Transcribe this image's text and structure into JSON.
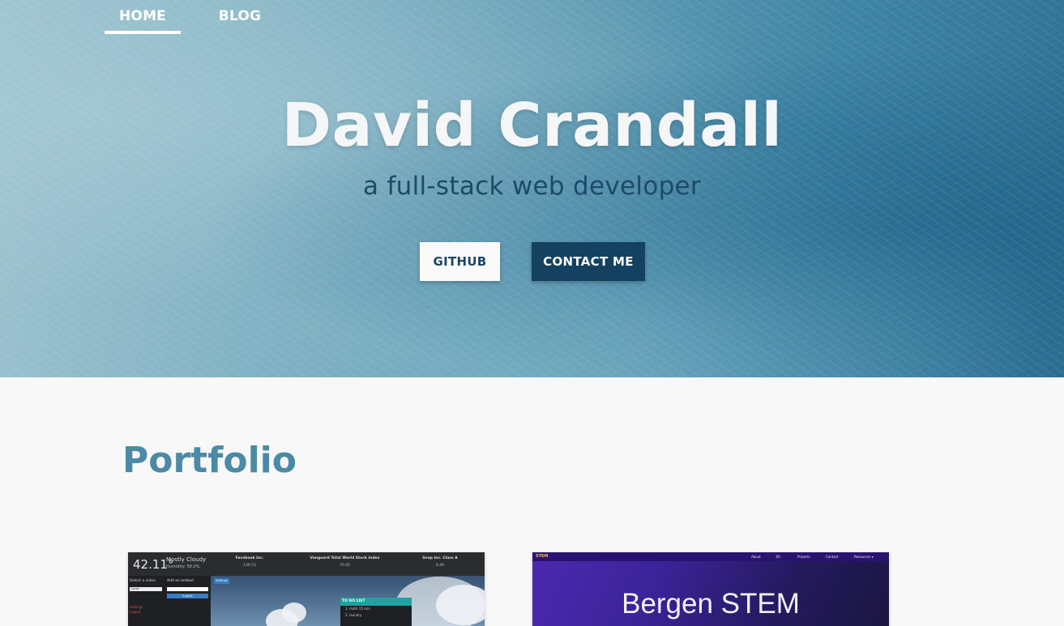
{
  "nav": {
    "home": "HOME",
    "blog": "BLOG"
  },
  "hero": {
    "title": "David Crandall",
    "subtitle": "a full-stack web developer",
    "github_label": "GITHUB",
    "contact_label": "CONTACT ME"
  },
  "portfolio": {
    "title": "Portfolio",
    "card1": {
      "temp": "42.11°",
      "condition": "Mostly Cloudy",
      "humidity": "Humidity: 56.0%",
      "stocks": [
        {
          "name": "Facebook Inc.",
          "value": "139.53"
        },
        {
          "name": "Vanguard Total World Stock Index",
          "value": "70.65"
        },
        {
          "name": "Snap Inc. Class A",
          "value": "6.49"
        }
      ],
      "select_label": "Select a video",
      "select_value": "Ocean",
      "embed_label": "Add an embed",
      "submit": "Submit",
      "settings_link": "Settings",
      "logout_link": "Logout",
      "settings_btn": "Settings",
      "todo_title": "TO DO LIST",
      "todo_items": [
        "1. math 15 min",
        "2. laundry"
      ]
    },
    "card2": {
      "logo": "STEM",
      "nav": [
        "About",
        "3S²",
        "Projects",
        "Contact",
        "Resources ▾"
      ],
      "title": "Bergen STEM"
    }
  },
  "colors": {
    "hero_dark": "#13415f",
    "portfolio_title": "#4a8aa6",
    "subtitle": "#1d4a66"
  }
}
